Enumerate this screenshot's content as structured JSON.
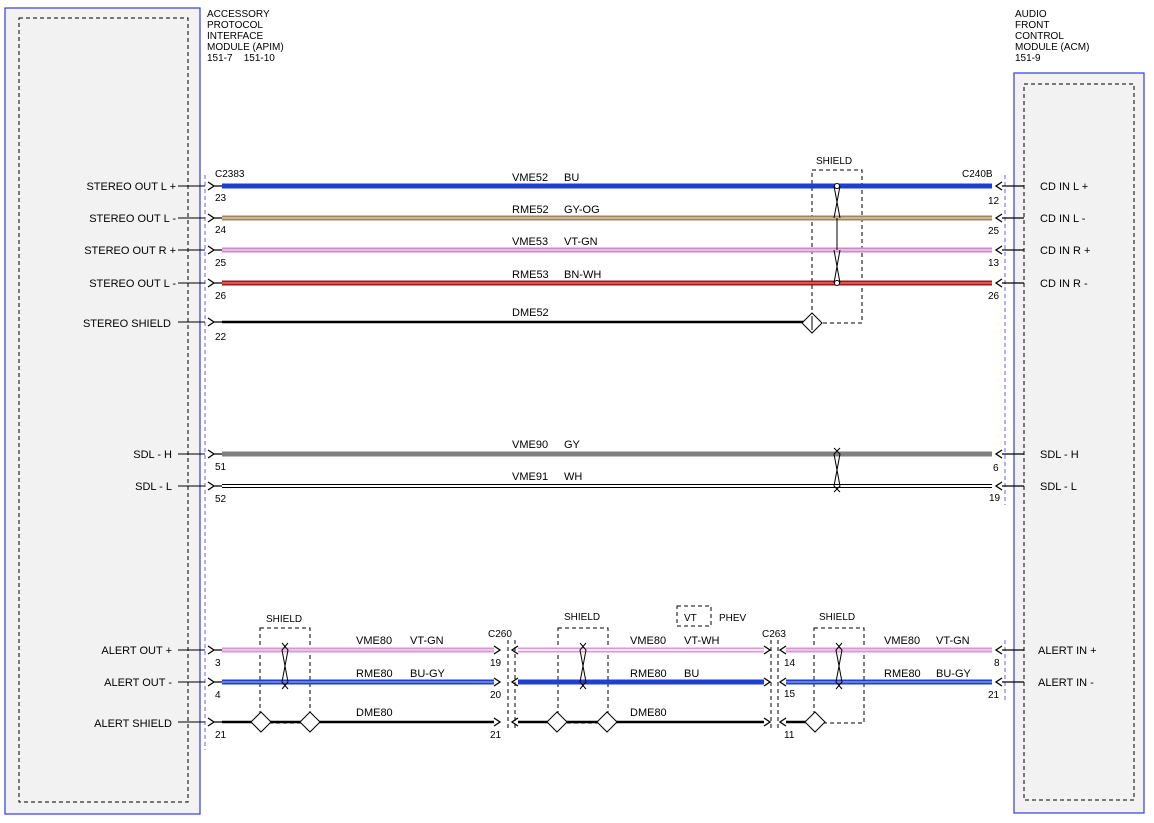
{
  "modules": {
    "left": {
      "title_lines": [
        "ACCESSORY",
        "PROTOCOL",
        "INTERFACE",
        "MODULE (APIM)"
      ],
      "refs": "151-7    151-10"
    },
    "right": {
      "title_lines": [
        "AUDIO",
        "FRONT",
        "CONTROL",
        "MODULE (ACM)"
      ],
      "refs": "151-9"
    }
  },
  "connectors": {
    "top_left": "C2383",
    "top_right": "C240B",
    "mid_left": "C260",
    "mid_right": "C263"
  },
  "labels": {
    "shield": "SHIELD",
    "option_box": "VT",
    "option_text": "PHEV"
  },
  "top_circuits": [
    {
      "left_label": "STEREO OUT L +",
      "right_label": "CD IN L +",
      "circuit": "VME52",
      "color_code": "BU",
      "left_pin": "23",
      "right_pin": "12",
      "color": "#1f3fd0",
      "stripe": "#1f3fd0"
    },
    {
      "left_label": "STEREO OUT L -",
      "right_label": "CD IN L -",
      "circuit": "RME52",
      "color_code": "GY-OG",
      "left_pin": "24",
      "right_pin": "25",
      "color": "#a08660",
      "stripe": "#c8b08a"
    },
    {
      "left_label": "STEREO OUT R +",
      "right_label": "CD IN R +",
      "circuit": "VME53",
      "color_code": "VT-GN",
      "left_pin": "25",
      "right_pin": "13",
      "color": "#c98ac6",
      "stripe": "#e6b9e2"
    },
    {
      "left_label": "STEREO OUT L -",
      "right_label": "CD IN R -",
      "circuit": "RME53",
      "color_code": "BN-WH",
      "left_pin": "26",
      "right_pin": "26",
      "color": "#a01818",
      "stripe": "#d04a4a"
    }
  ],
  "stereo_shield": {
    "left_label": "STEREO SHIELD",
    "circuit": "DME52",
    "left_pin": "22"
  },
  "sdl": [
    {
      "left_label": "SDL - H",
      "right_label": "SDL - H",
      "circuit": "VME90",
      "color_code": "GY",
      "left_pin": "51",
      "right_pin": "6",
      "color": "#808080"
    },
    {
      "left_label": "SDL - L",
      "right_label": "SDL - L",
      "circuit": "VME91",
      "color_code": "WH",
      "left_pin": "52",
      "right_pin": "19",
      "color": "#ffffff"
    }
  ],
  "alert": {
    "plus": {
      "left_label": "ALERT OUT +",
      "right_label": "ALERT IN +",
      "circuit": "VME80",
      "color_code_a": "VT-GN",
      "color_code_b": "VT-WH",
      "pins": [
        "3",
        "19",
        "14",
        "8"
      ],
      "color": "#d79ad2"
    },
    "minus": {
      "left_label": "ALERT OUT -",
      "right_label": "ALERT IN -",
      "circuit": "RME80",
      "color_code_a": "BU-GY",
      "color_code_b": "BU",
      "pins": [
        "4",
        "20",
        "15",
        "21"
      ],
      "color": "#1f3fd0"
    },
    "shield": {
      "left_label": "ALERT SHIELD",
      "circuit": "DME80",
      "pins": [
        "21",
        "21",
        "11"
      ]
    }
  }
}
